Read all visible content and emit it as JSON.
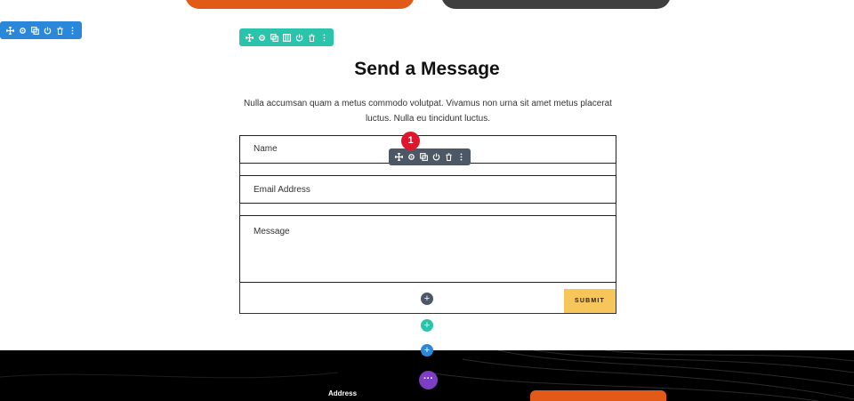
{
  "content": {
    "heading": "Send a Message",
    "body_line_1": "Nulla accumsan quam a metus commodo volutpat. Vivamus non urna sit amet metus placerat",
    "body_line_2": "luctus. Nulla eu tincidunt luctus."
  },
  "form": {
    "name_placeholder": "Name",
    "email_placeholder": "Email Address",
    "message_placeholder": "Message",
    "submit_label": "SUBMIT"
  },
  "badge": {
    "number": "1"
  },
  "footer": {
    "address_label": "Address"
  },
  "toolbars": {
    "section": [
      "move-icon",
      "gear-icon",
      "duplicate-icon",
      "power-icon",
      "trash-icon",
      "more-vertical-icon"
    ],
    "row": [
      "move-icon",
      "gear-icon",
      "duplicate-icon",
      "columns-icon",
      "power-icon",
      "trash-icon",
      "more-vertical-icon"
    ],
    "module": [
      "move-icon",
      "gear-icon",
      "duplicate-icon",
      "power-icon",
      "trash-icon",
      "more-vertical-icon"
    ]
  },
  "colors": {
    "section_blue": "#2b87da",
    "row_teal": "#29c4a9",
    "module_gray": "#4c5866",
    "orange": "#e25a17",
    "submit_yellow": "#f6c65a",
    "badge_red": "#e0142a",
    "purple": "#7d3dc4"
  }
}
